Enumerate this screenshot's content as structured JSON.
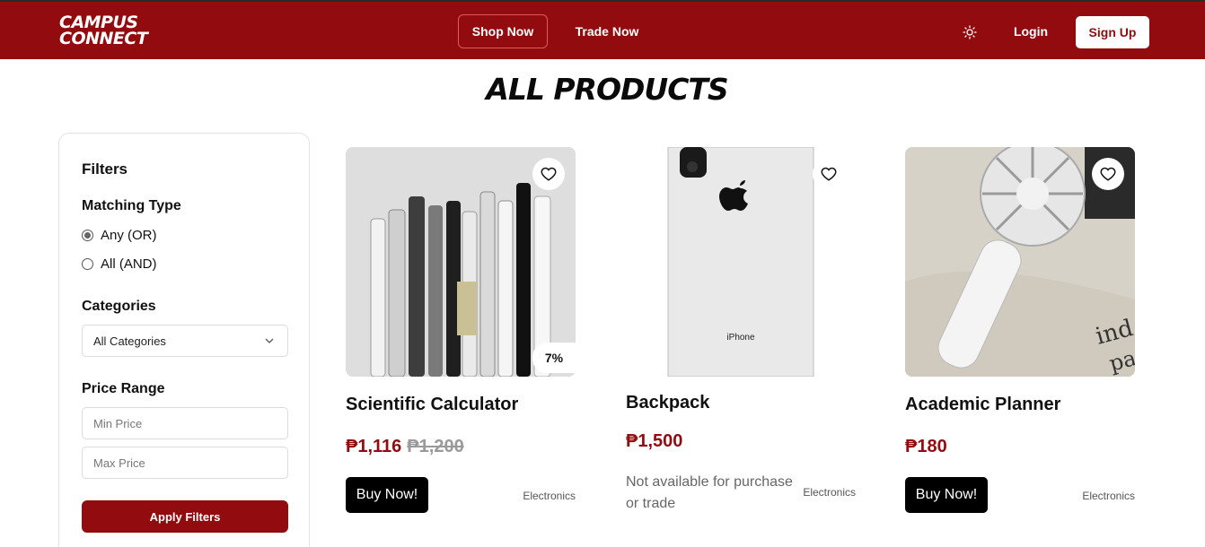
{
  "header": {
    "logo_line1": "CAMPUS",
    "logo_line2": "CONNECT",
    "nav": {
      "shop": "Shop Now",
      "trade": "Trade Now"
    },
    "login": "Login",
    "signup": "Sign Up",
    "theme_icon": "sun-icon"
  },
  "page_title": "ALL PRODUCTS",
  "filters": {
    "title": "Filters",
    "matching_label": "Matching Type",
    "match_any": "Any (OR)",
    "match_all": "All (AND)",
    "categories_label": "Categories",
    "category_selected": "All Categories",
    "price_label": "Price Range",
    "min_placeholder": "Min Price",
    "max_placeholder": "Max Price",
    "apply": "Apply Filters"
  },
  "products": [
    {
      "name": "Scientific Calculator",
      "price": "₱1,116",
      "old_price": "₱1,200",
      "discount": "7%",
      "category": "Electronics",
      "action": "Buy Now!"
    },
    {
      "name": "Backpack",
      "price": "₱1,500",
      "status": "Not available for purchase or trade",
      "category": "Electronics",
      "image_text": "iPhone"
    },
    {
      "name": "Academic Planner",
      "price": "₱180",
      "category": "Electronics",
      "action": "Buy Now!"
    }
  ],
  "colors": {
    "brand": "#920c0f",
    "accent_text": "#920c0f"
  }
}
